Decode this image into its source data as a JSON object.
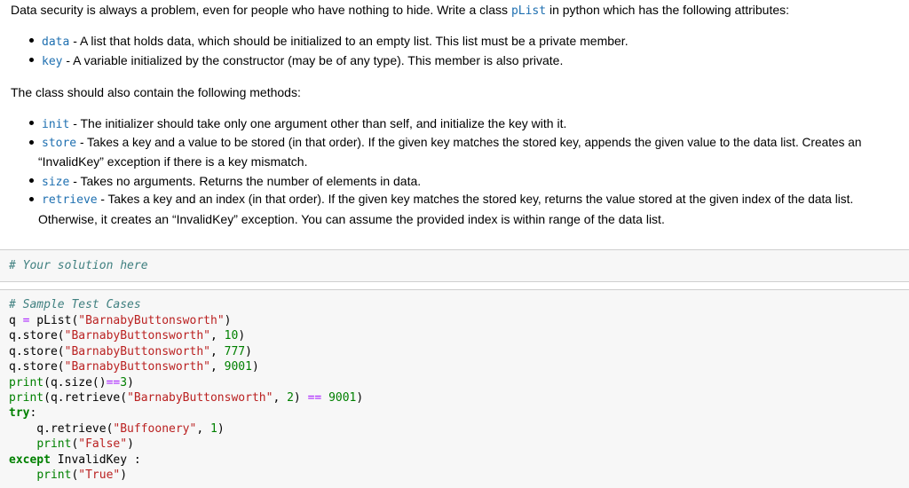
{
  "intro": {
    "text_before": "Data security is always a problem, even for people who have nothing to hide. Write a class ",
    "class_name": "pList",
    "text_after": " in python which has the following attributes:"
  },
  "attributes": [
    {
      "name": "data",
      "desc": " - A list that holds data, which should be initialized to an empty list. This list must be a private member."
    },
    {
      "name": "key",
      "desc": " - A variable initialized by the constructor (may be of any type). This member is also private."
    }
  ],
  "methods_intro": "The class should also contain the following methods:",
  "methods": [
    {
      "name": "init",
      "desc": " - The initializer should take only one argument other than self, and initialize the key with it.",
      "desc2": ""
    },
    {
      "name": "store",
      "desc": " - Takes a key and a value to be stored (in that order). If the given key matches the stored key, appends the given value to the data list. Creates an",
      "desc2": "“InvalidKey” exception if there is a key mismatch."
    },
    {
      "name": "size",
      "desc": " - Takes no arguments. Returns the number of elements in data.",
      "desc2": ""
    },
    {
      "name": "retrieve",
      "desc": " - Takes a key and an index (in that order). If the given key matches the stored key, returns the value stored at the given index of the data list.",
      "desc2": "Otherwise, it creates an “InvalidKey” exception. You can assume the provided index is within range of the data list."
    }
  ],
  "solution_cell": {
    "comment": "# Your solution here"
  },
  "test_cell": {
    "comment": "# Sample Test Cases",
    "lines": [
      [
        [
          "tx",
          "q "
        ],
        [
          "op",
          "="
        ],
        [
          "tx",
          " pList("
        ],
        [
          "st",
          "\"BarnabyButtonsworth\""
        ],
        [
          "tx",
          ")"
        ]
      ],
      [
        [
          "tx",
          "q.store("
        ],
        [
          "st",
          "\"BarnabyButtonsworth\""
        ],
        [
          "tx",
          ", "
        ],
        [
          "nm",
          "10"
        ],
        [
          "tx",
          ")"
        ]
      ],
      [
        [
          "tx",
          "q.store("
        ],
        [
          "st",
          "\"BarnabyButtonsworth\""
        ],
        [
          "tx",
          ", "
        ],
        [
          "nm",
          "777"
        ],
        [
          "tx",
          ")"
        ]
      ],
      [
        [
          "tx",
          "q.store("
        ],
        [
          "st",
          "\"BarnabyButtonsworth\""
        ],
        [
          "tx",
          ", "
        ],
        [
          "nm",
          "9001"
        ],
        [
          "tx",
          ")"
        ]
      ],
      [
        [
          "bi",
          "print"
        ],
        [
          "tx",
          "(q.size()"
        ],
        [
          "op",
          "=="
        ],
        [
          "nm",
          "3"
        ],
        [
          "tx",
          ")"
        ]
      ],
      [
        [
          "bi",
          "print"
        ],
        [
          "tx",
          "(q.retrieve("
        ],
        [
          "st",
          "\"BarnabyButtonsworth\""
        ],
        [
          "tx",
          ", "
        ],
        [
          "nm",
          "2"
        ],
        [
          "tx",
          ") "
        ],
        [
          "op",
          "=="
        ],
        [
          "tx",
          " "
        ],
        [
          "nm",
          "9001"
        ],
        [
          "tx",
          ")"
        ]
      ],
      [
        [
          "kw",
          "try"
        ],
        [
          "tx",
          ":"
        ]
      ],
      [
        [
          "tx",
          "    q.retrieve("
        ],
        [
          "st",
          "\"Buffoonery\""
        ],
        [
          "tx",
          ", "
        ],
        [
          "nm",
          "1"
        ],
        [
          "tx",
          ")"
        ]
      ],
      [
        [
          "tx",
          "    "
        ],
        [
          "bi",
          "print"
        ],
        [
          "tx",
          "("
        ],
        [
          "st",
          "\"False\""
        ],
        [
          "tx",
          ")"
        ]
      ],
      [
        [
          "kw",
          "except"
        ],
        [
          "tx",
          " InvalidKey :"
        ]
      ],
      [
        [
          "tx",
          "    "
        ],
        [
          "bi",
          "print"
        ],
        [
          "tx",
          "("
        ],
        [
          "st",
          "\"True\""
        ],
        [
          "tx",
          ")"
        ]
      ]
    ]
  }
}
